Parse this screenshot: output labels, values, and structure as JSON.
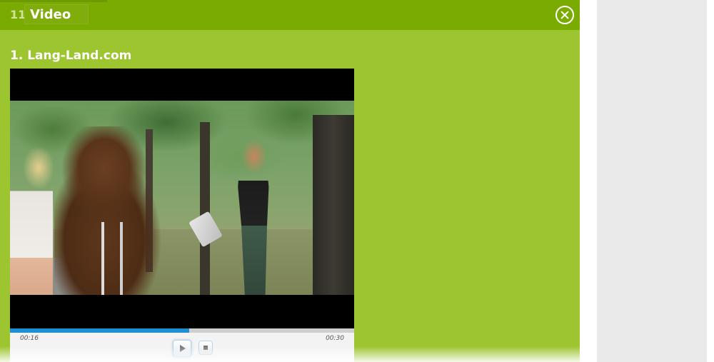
{
  "header": {
    "step_number": "11",
    "title": "Video",
    "close_icon": "close-icon"
  },
  "section": {
    "title": "1. Lang-Land.com"
  },
  "player": {
    "current_time": "00:16",
    "total_time": "00:30",
    "progress_fraction": 0.52,
    "play_icon": "play-icon",
    "stop_icon": "stop-icon",
    "progress_color": "#1d8fd3"
  },
  "colors": {
    "panel_background": "#9dc52f",
    "header_background": "#7aab00"
  }
}
